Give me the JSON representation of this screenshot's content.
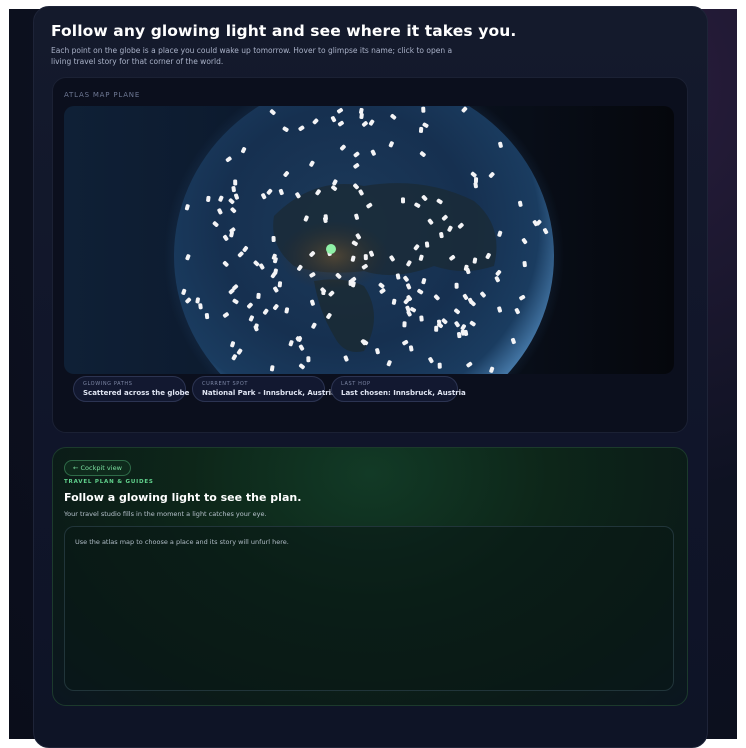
{
  "header": {
    "title": "Follow any glowing light and see where it takes you.",
    "subtitle": "Each point on the globe is a place you could wake up tomorrow. Hover to glimpse its name; click to open a living travel story for that corner of the world."
  },
  "atlas": {
    "label": "ATLAS MAP PLANE",
    "chips": [
      {
        "key": "GLOWING PATHS",
        "value": "Scattered across the globe"
      },
      {
        "key": "CURRENT SPOT",
        "value": "National Park - Innsbruck, Austria"
      },
      {
        "key": "LAST HOP",
        "value": "Last chosen: Innsbruck, Austria"
      }
    ]
  },
  "plan": {
    "back_label": "← Cockpit view",
    "kicker": "TRAVEL PLAN & GUIDES",
    "title": "Follow a glowing light to see the plan.",
    "subtitle": "Your travel studio fills in the moment a light catches your eye.",
    "placeholder": "Use the atlas map to choose a place and its story will unfurl here."
  },
  "colors": {
    "accent_green": "#62d48e",
    "marker_white": "#f4f4f6",
    "selected_marker": "#8ff0a6"
  }
}
